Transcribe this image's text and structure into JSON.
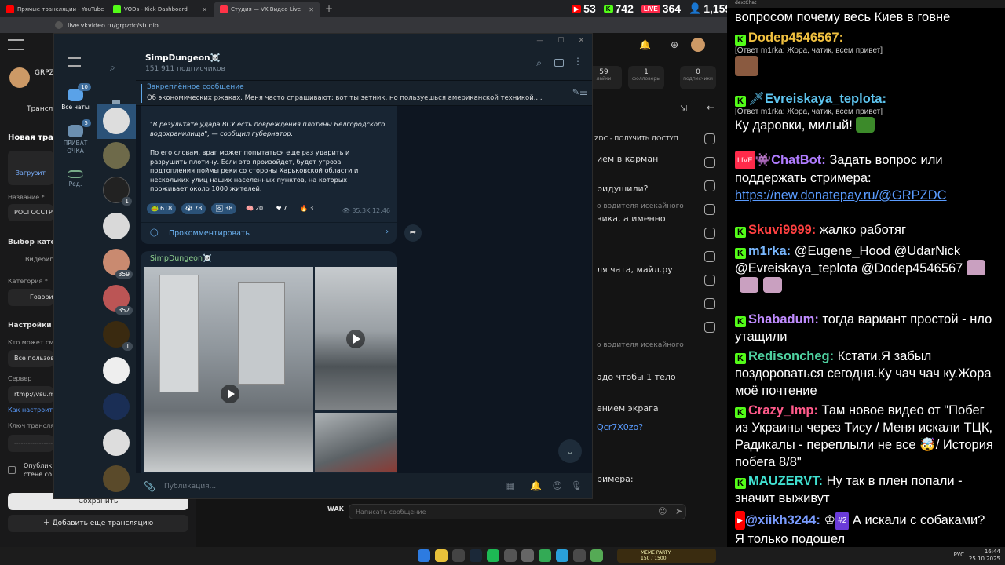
{
  "browser": {
    "tabs": [
      {
        "label": "Прямые трансляции - YouTube",
        "color": "#ff0000"
      },
      {
        "label": "VODs - Kick Dashboard",
        "color": "#53fc18"
      },
      {
        "label": "Студия — VK Видео Live",
        "color": "#ff3347"
      }
    ],
    "new_tab": "+",
    "url": "live.vkvideo.ru/grpzdc/studio"
  },
  "stream_stats": {
    "youtube": "53",
    "kick": "742",
    "vk": "364",
    "total": "1,159"
  },
  "vk": {
    "channel_name": "GRPZD",
    "left": {
      "tab_label": "Трансля",
      "new_stream_title": "Новая тран",
      "upload_label": "Загрузит",
      "name_label": "Название *",
      "name_value": "РОСГОССТР",
      "category_choice": "Выбор катего",
      "video_label": "Видеоиг",
      "category_label": "Категория *",
      "category_value": "Говори",
      "settings": "Настройки",
      "who_can": "Кто может смо",
      "all_users": "Все пользов",
      "server_label": "Сервер",
      "server_value": "rtmp://vsu.my",
      "how_setup": "Как настроить",
      "key_label": "Ключ трансляц",
      "key_value": "------------------",
      "publish_label": "Опублик стене со",
      "save": "Сохранить",
      "add_stream": "Добавить еще трансляцию"
    },
    "stats": [
      {
        "value": "59",
        "label": "лайки"
      },
      {
        "value": "1",
        "label": "фолловеры"
      },
      {
        "value": "0",
        "label": "подписчики"
      }
    ],
    "chat_lines": [
      "ZDC - ПОЛУЧИТЬ ДОСТУП ...",
      "ием в карман",
      "ридушили?",
      "о водителя исекайного",
      "вика, а именно",
      "ля чата, майл.ру",
      "о водителя исекайного",
      "адо чтобы 1 тело",
      "ением экрага",
      "Qcr7X0zo?",
      "римера:"
    ],
    "chat_sender": "WAK",
    "message_placeholder": "Написать сообщение"
  },
  "telegram": {
    "nav": [
      {
        "label": "Все чаты",
        "badge": "10"
      },
      {
        "label": "ПРИВАТ ОЧКА",
        "badge": "5"
      },
      {
        "label": "Ред.",
        "badge": ""
      }
    ],
    "chat_list_badges": [
      "1",
      "359",
      "352",
      "1"
    ],
    "channel_title": "SimpDungeon☠️",
    "subscribers": "151 911 подписчиков",
    "pinned_title": "Закреплённое сообщение",
    "pinned_text": "Об экономических ржаках.  Меня часто спрашивают: вот ты зетник, но пользуешься американской техникой....",
    "post": {
      "quote": "\"В результате удара ВСУ есть повреждения плотины Белгородского водохранилища\", — сообщил губернатор.",
      "body": "По его словам, враг может попытаться еще раз ударить и разрушить плотину. Если это произойдет, будет угроза подтопления поймы реки со стороны Харьковской области и нескольких улиц наших населенных пунктов, на которых проживает около 1000 жителей.",
      "reactions": [
        {
          "emoji": "🐸",
          "count": "618"
        },
        {
          "emoji": "😭",
          "count": "78"
        },
        {
          "emoji": "🖼",
          "count": "38"
        },
        {
          "emoji": "🧠",
          "count": "20"
        },
        {
          "emoji": "❤",
          "count": "7"
        },
        {
          "emoji": "🔥",
          "count": "3"
        }
      ],
      "views": "35.3K",
      "time": "12:46",
      "comment": "Прокомментировать"
    },
    "post2_author": "SimpDungeon☠️",
    "compose_placeholder": "Публикация..."
  },
  "chat": {
    "window_title": "dextChat",
    "messages": [
      {
        "name": "",
        "color": "#ffffff",
        "text": "вопросом почему весь Киев в говне",
        "platform": "none"
      },
      {
        "name": "Dodep4546567:",
        "color": "#f0c040",
        "reply": "[Ответ m1rka: Жора, чатик, всем привет]",
        "text": "",
        "platform": "kick"
      },
      {
        "name": "Evreiskaya_teplota:",
        "color": "#5ec5f0",
        "reply": "[Ответ m1rka: Жора, чатик, всем привет]",
        "text": "Ку даровки, милый!",
        "platform": "kick"
      },
      {
        "name": "ChatBot:",
        "color": "#b07cff",
        "text": "Задать вопрос или поддержать стримера:",
        "link": "https://new.donatepay.ru/@GRPZDC",
        "platform": "vk"
      },
      {
        "name": "Skuvi9999:",
        "color": "#ff4040",
        "text": "жалко работяг",
        "platform": "kick"
      },
      {
        "name": "m1rka:",
        "color": "#7ab8ff",
        "text": "@Eugene_Hood @UdarNick @Evreiskaya_teplota @Dodep4546567",
        "platform": "kick"
      },
      {
        "name": "Shabadum:",
        "color": "#c08cff",
        "text": "тогда вариант простой - нло утащили",
        "platform": "kick"
      },
      {
        "name": "Redisoncheg:",
        "color": "#4fd1a0",
        "text": "Кстати.Я забыл поздороваться сегодня.Ку чач чач ку.Жора моё почтение",
        "platform": "kick"
      },
      {
        "name": "Crazy_Imp:",
        "color": "#ff5a8a",
        "text": "Там новое видео от \"Побег из Украины через Тису / Меня искали ТЦК, Радикалы - переплыли не все 🤯/ История побега 8/8\"",
        "platform": "kick"
      },
      {
        "name": "MAUZERVT:",
        "color": "#40e0d0",
        "text": "Ну так в плен попали - значит выживут",
        "platform": "kick"
      },
      {
        "name": "@xiikh3244:",
        "color": "#7a9cff",
        "badge": "#2",
        "text": "А искали с собаками? Я только подошел",
        "platform": "youtube"
      }
    ]
  },
  "taskbar": {
    "lang": "РУС",
    "time": "16:44",
    "date": "25.10.2025",
    "memes_label": "MEME PARTY",
    "memes_count": "150 / 1500"
  }
}
